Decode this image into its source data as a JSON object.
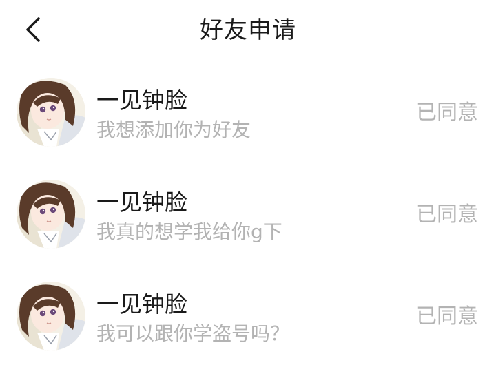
{
  "header": {
    "title": "好友申请",
    "back_icon": "chevron-left-icon"
  },
  "requests": [
    {
      "name": "一见钟脸",
      "message": "我想添加你为好友",
      "status": "已同意"
    },
    {
      "name": "一见钟脸",
      "message": "我真的想学我给你g下",
      "status": "已同意"
    },
    {
      "name": "一见钟脸",
      "message": "我可以跟你学盗号吗？",
      "status": "已同意"
    }
  ]
}
